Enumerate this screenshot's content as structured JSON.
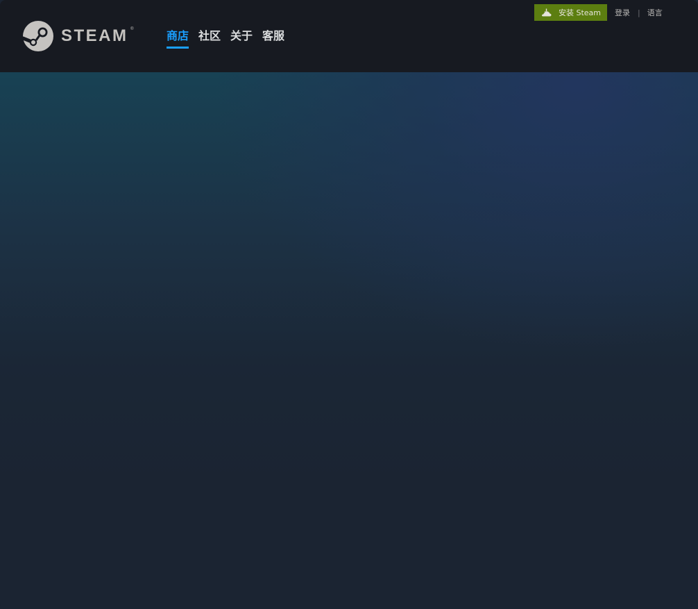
{
  "header": {
    "logo": {
      "text": "STEAM",
      "registered_mark": "®",
      "icon": "steam-logo-icon"
    },
    "nav": [
      {
        "label": "商店",
        "active": true
      },
      {
        "label": "社区",
        "active": false
      },
      {
        "label": "关于",
        "active": false
      },
      {
        "label": "客服",
        "active": false
      }
    ],
    "actions": {
      "install_label": "安装 Steam",
      "install_icon": "download-cloud-icon",
      "login_label": "登录",
      "separator": "|",
      "language_label": "语言"
    }
  },
  "colors": {
    "header_bg": "#171a21",
    "page_bg": "#1b2432",
    "active_nav": "#1a9fff",
    "install_button": "#5c7e10"
  }
}
